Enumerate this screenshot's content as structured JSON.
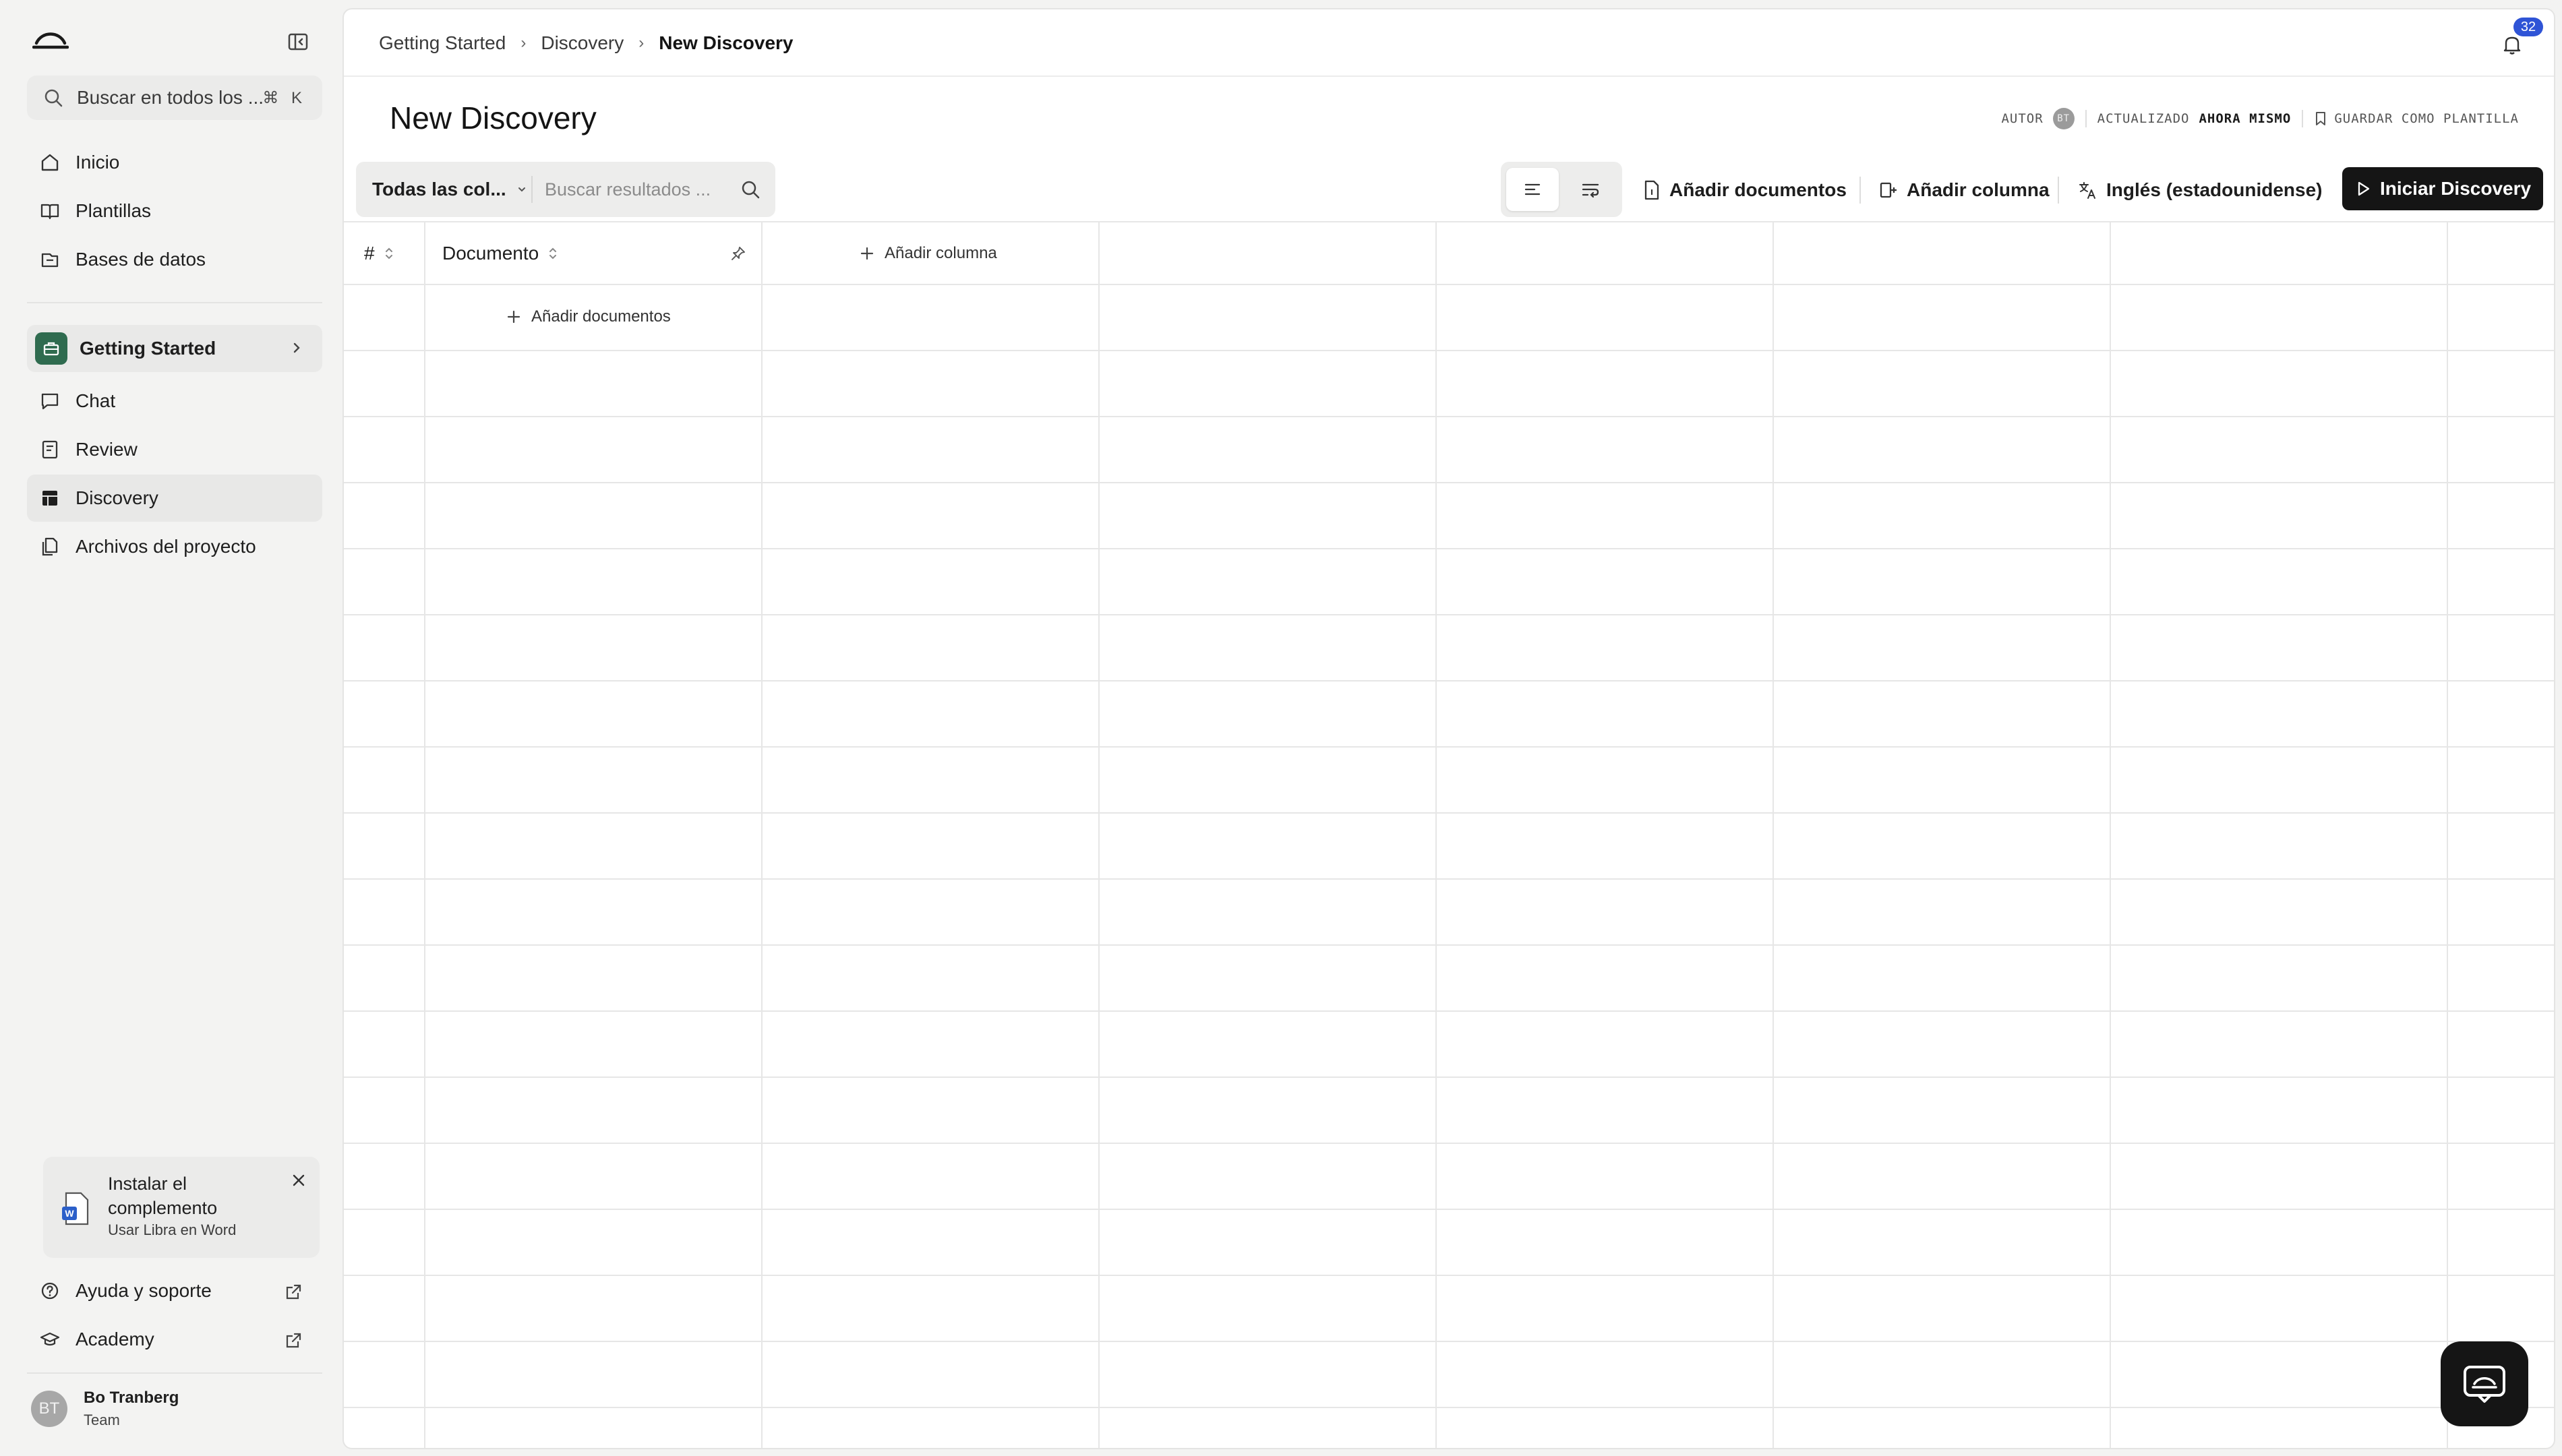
{
  "sidebar": {
    "search_placeholder": "Buscar en todos los ...",
    "search_shortcut": "⌘ K",
    "nav": [
      "Inicio",
      "Plantillas",
      "Bases de datos"
    ],
    "project": "Getting Started",
    "project_nav": [
      "Chat",
      "Review",
      "Discovery",
      "Archivos del proyecto"
    ],
    "active_item": "Discovery",
    "addin": {
      "title": "Instalar el complemento",
      "subtitle": "Usar Libra en Word"
    },
    "footer_links": [
      "Ayuda y soporte",
      "Academy"
    ],
    "user": {
      "initials": "BT",
      "name": "Bo Tranberg",
      "team": "Team"
    }
  },
  "breadcrumb": [
    "Getting Started",
    "Discovery",
    "New Discovery"
  ],
  "notifications_count": "32",
  "page": {
    "title": "New Discovery",
    "meta": {
      "author_label": "AUTOR",
      "author_initials": "BT",
      "updated_label": "ACTUALIZADO",
      "updated_value": "AHORA MISMO",
      "save_template": "GUARDAR COMO PLANTILLA"
    }
  },
  "toolbar": {
    "filter_select": "Todas las col...",
    "search_placeholder": "Buscar resultados ...",
    "add_documents": "Añadir documentos",
    "add_column": "Añadir columna",
    "language": "Inglés (estadounidense)",
    "start": "Iniciar Discovery"
  },
  "table": {
    "headers": {
      "index": "#",
      "document": "Documento"
    },
    "add_column": "Añadir columna",
    "add_documents": "Añadir documentos"
  },
  "colors": {
    "accent_primary": "#151515",
    "project_badge": "#2f6b4f",
    "notification_badge": "#2f54d6",
    "word_blue": "#2b5fc9"
  }
}
